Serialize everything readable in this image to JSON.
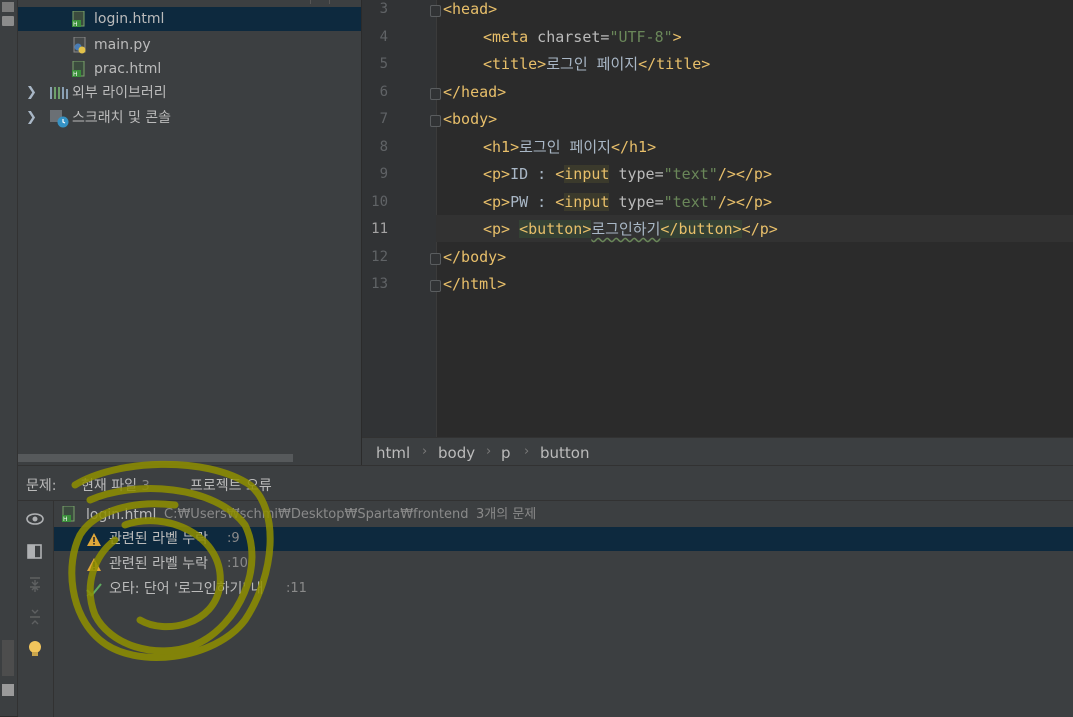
{
  "project_tree": {
    "items": [
      {
        "label": "login.html",
        "type": "html",
        "selected": true
      },
      {
        "label": "main.py",
        "type": "python",
        "selected": false
      },
      {
        "label": "prac.html",
        "type": "html",
        "selected": false
      },
      {
        "label": "외부 라이브러리",
        "type": "library",
        "expandable": true
      },
      {
        "label": "스크래치 및 콘솔",
        "type": "scratch",
        "expandable": true
      }
    ]
  },
  "editor": {
    "line_numbers": [
      "3",
      "4",
      "5",
      "6",
      "7",
      "8",
      "9",
      "10",
      "11",
      "12",
      "13"
    ],
    "current_line": "11",
    "lines": {
      "l3": {
        "open": "<head>"
      },
      "l4": {
        "tag": "<meta",
        "attr": " charset=",
        "val": "\"UTF-8\"",
        "close": ">"
      },
      "l5": {
        "open": "<title>",
        "text": "로그인 페이지",
        "close": "</title>"
      },
      "l6": {
        "open": "</head>"
      },
      "l7": {
        "open": "<body>"
      },
      "l8": {
        "open": "<h1>",
        "text": "로그인 페이지",
        "close": "</h1>"
      },
      "l9": {
        "p_open": "<p>",
        "text": "ID : ",
        "lt": "<",
        "tag": "input",
        "attr": " type=",
        "val": "\"text\"",
        "end": "/>",
        "p_close": "</p>"
      },
      "l10": {
        "p_open": "<p>",
        "text": "PW : ",
        "lt": "<",
        "tag": "input",
        "attr": " type=",
        "val": "\"text\"",
        "end": "/>",
        "p_close": "</p>"
      },
      "l11": {
        "p_open": "<p>",
        "btn_open": "<button>",
        "text": "로그인하기",
        "btn_close": "</button>",
        "p_close": "</p>"
      },
      "l12": {
        "open": "</body>"
      },
      "l13": {
        "open": "</html>"
      }
    }
  },
  "breadcrumb": [
    "html",
    "body",
    "p",
    "button"
  ],
  "problems": {
    "label": "문제:",
    "tabs": [
      {
        "label": "현재 파일",
        "count": "3"
      },
      {
        "label": "프로젝트 오류",
        "count": ""
      }
    ],
    "file": {
      "name": "login.html",
      "path": "C:₩Users₩schmi₩Desktop₩Sparta₩frontend",
      "summary": "3개의 문제"
    },
    "items": [
      {
        "severity": "warning",
        "text": "관련된 라벨 누락",
        "loc": ":9"
      },
      {
        "severity": "warning",
        "text": "관련된 라벨 누락",
        "loc": ":10"
      },
      {
        "severity": "typo",
        "text": "오타: 단어 '로그인하기' 내",
        "loc": ":11"
      }
    ]
  },
  "colors": {
    "background": "#2b2b2b",
    "panel": "#3c3f41",
    "selection": "#0d293e",
    "tag": "#e8bf6a",
    "string": "#6a8759",
    "warning": "#e0a83a",
    "annotation": "#8f8f00"
  },
  "icons": [
    "html-file-icon",
    "python-file-icon",
    "library-icon",
    "scratch-icon",
    "eye-icon",
    "preview-icon",
    "expand-icon",
    "collapse-icon",
    "bulb-icon",
    "warning-icon",
    "typo-check-icon"
  ]
}
